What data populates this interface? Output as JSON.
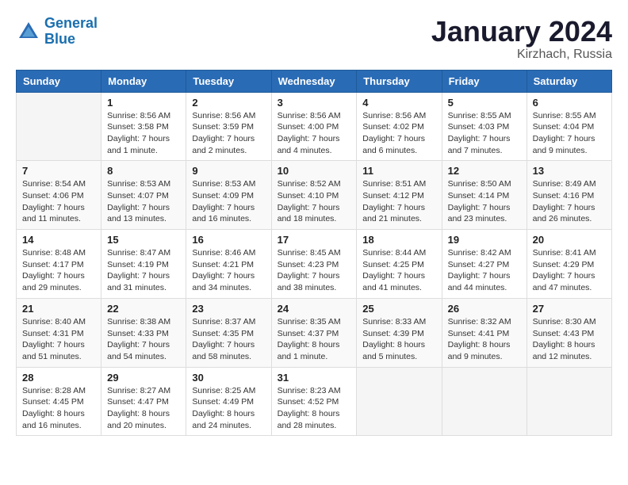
{
  "header": {
    "logo_line1": "General",
    "logo_line2": "Blue",
    "month_title": "January 2024",
    "location": "Kirzhach, Russia"
  },
  "weekdays": [
    "Sunday",
    "Monday",
    "Tuesday",
    "Wednesday",
    "Thursday",
    "Friday",
    "Saturday"
  ],
  "weeks": [
    [
      {
        "day": "",
        "info": ""
      },
      {
        "day": "1",
        "info": "Sunrise: 8:56 AM\nSunset: 3:58 PM\nDaylight: 7 hours\nand 1 minute."
      },
      {
        "day": "2",
        "info": "Sunrise: 8:56 AM\nSunset: 3:59 PM\nDaylight: 7 hours\nand 2 minutes."
      },
      {
        "day": "3",
        "info": "Sunrise: 8:56 AM\nSunset: 4:00 PM\nDaylight: 7 hours\nand 4 minutes."
      },
      {
        "day": "4",
        "info": "Sunrise: 8:56 AM\nSunset: 4:02 PM\nDaylight: 7 hours\nand 6 minutes."
      },
      {
        "day": "5",
        "info": "Sunrise: 8:55 AM\nSunset: 4:03 PM\nDaylight: 7 hours\nand 7 minutes."
      },
      {
        "day": "6",
        "info": "Sunrise: 8:55 AM\nSunset: 4:04 PM\nDaylight: 7 hours\nand 9 minutes."
      }
    ],
    [
      {
        "day": "7",
        "info": "Sunrise: 8:54 AM\nSunset: 4:06 PM\nDaylight: 7 hours\nand 11 minutes."
      },
      {
        "day": "8",
        "info": "Sunrise: 8:53 AM\nSunset: 4:07 PM\nDaylight: 7 hours\nand 13 minutes."
      },
      {
        "day": "9",
        "info": "Sunrise: 8:53 AM\nSunset: 4:09 PM\nDaylight: 7 hours\nand 16 minutes."
      },
      {
        "day": "10",
        "info": "Sunrise: 8:52 AM\nSunset: 4:10 PM\nDaylight: 7 hours\nand 18 minutes."
      },
      {
        "day": "11",
        "info": "Sunrise: 8:51 AM\nSunset: 4:12 PM\nDaylight: 7 hours\nand 21 minutes."
      },
      {
        "day": "12",
        "info": "Sunrise: 8:50 AM\nSunset: 4:14 PM\nDaylight: 7 hours\nand 23 minutes."
      },
      {
        "day": "13",
        "info": "Sunrise: 8:49 AM\nSunset: 4:16 PM\nDaylight: 7 hours\nand 26 minutes."
      }
    ],
    [
      {
        "day": "14",
        "info": "Sunrise: 8:48 AM\nSunset: 4:17 PM\nDaylight: 7 hours\nand 29 minutes."
      },
      {
        "day": "15",
        "info": "Sunrise: 8:47 AM\nSunset: 4:19 PM\nDaylight: 7 hours\nand 31 minutes."
      },
      {
        "day": "16",
        "info": "Sunrise: 8:46 AM\nSunset: 4:21 PM\nDaylight: 7 hours\nand 34 minutes."
      },
      {
        "day": "17",
        "info": "Sunrise: 8:45 AM\nSunset: 4:23 PM\nDaylight: 7 hours\nand 38 minutes."
      },
      {
        "day": "18",
        "info": "Sunrise: 8:44 AM\nSunset: 4:25 PM\nDaylight: 7 hours\nand 41 minutes."
      },
      {
        "day": "19",
        "info": "Sunrise: 8:42 AM\nSunset: 4:27 PM\nDaylight: 7 hours\nand 44 minutes."
      },
      {
        "day": "20",
        "info": "Sunrise: 8:41 AM\nSunset: 4:29 PM\nDaylight: 7 hours\nand 47 minutes."
      }
    ],
    [
      {
        "day": "21",
        "info": "Sunrise: 8:40 AM\nSunset: 4:31 PM\nDaylight: 7 hours\nand 51 minutes."
      },
      {
        "day": "22",
        "info": "Sunrise: 8:38 AM\nSunset: 4:33 PM\nDaylight: 7 hours\nand 54 minutes."
      },
      {
        "day": "23",
        "info": "Sunrise: 8:37 AM\nSunset: 4:35 PM\nDaylight: 7 hours\nand 58 minutes."
      },
      {
        "day": "24",
        "info": "Sunrise: 8:35 AM\nSunset: 4:37 PM\nDaylight: 8 hours\nand 1 minute."
      },
      {
        "day": "25",
        "info": "Sunrise: 8:33 AM\nSunset: 4:39 PM\nDaylight: 8 hours\nand 5 minutes."
      },
      {
        "day": "26",
        "info": "Sunrise: 8:32 AM\nSunset: 4:41 PM\nDaylight: 8 hours\nand 9 minutes."
      },
      {
        "day": "27",
        "info": "Sunrise: 8:30 AM\nSunset: 4:43 PM\nDaylight: 8 hours\nand 12 minutes."
      }
    ],
    [
      {
        "day": "28",
        "info": "Sunrise: 8:28 AM\nSunset: 4:45 PM\nDaylight: 8 hours\nand 16 minutes."
      },
      {
        "day": "29",
        "info": "Sunrise: 8:27 AM\nSunset: 4:47 PM\nDaylight: 8 hours\nand 20 minutes."
      },
      {
        "day": "30",
        "info": "Sunrise: 8:25 AM\nSunset: 4:49 PM\nDaylight: 8 hours\nand 24 minutes."
      },
      {
        "day": "31",
        "info": "Sunrise: 8:23 AM\nSunset: 4:52 PM\nDaylight: 8 hours\nand 28 minutes."
      },
      {
        "day": "",
        "info": ""
      },
      {
        "day": "",
        "info": ""
      },
      {
        "day": "",
        "info": ""
      }
    ]
  ]
}
